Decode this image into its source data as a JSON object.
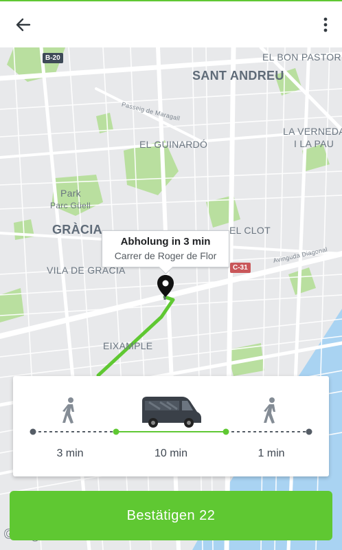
{
  "colors": {
    "accent": "#5fc832",
    "route": "#5fc832",
    "park": "#b9df9f"
  },
  "appbar": {
    "back_icon": "arrow-left-icon",
    "menu_icon": "more-vertical-icon"
  },
  "map": {
    "labels": {
      "el_bon_pastor": "EL BON PASTOR",
      "sant_andreu": "SANT ANDREU",
      "passeig_maragall": "Passeig de Maragall",
      "la_verneda_1": "LA VERNEDA",
      "la_verneda_2": "I LA PAU",
      "el_guinardo": "EL GUINARDÓ",
      "park": "Park",
      "parc_guell": "Parc Güell",
      "gracia": "GRÀCIA",
      "el_clot": "EL CLOT",
      "avinguda_diagonal": "Avinguda Diagonal",
      "vila_de_gracia": "VILA DE GRÀCIA",
      "eixample": "EIXAMPLE",
      "b20": "B-20",
      "c31": "C-31"
    },
    "pin_icon": "location-pin-icon",
    "callout": {
      "title": "Abholung in 3 min",
      "subtitle": "Carrer de Roger de Flor"
    },
    "google_logo": "Google"
  },
  "trip": {
    "walk_icon": "walking-person-icon",
    "vehicle_icon": "van-icon",
    "legs": {
      "walk1": "3 min",
      "ride": "10 min",
      "walk2": "1 min"
    }
  },
  "confirm_button": "Bestätigen 22"
}
